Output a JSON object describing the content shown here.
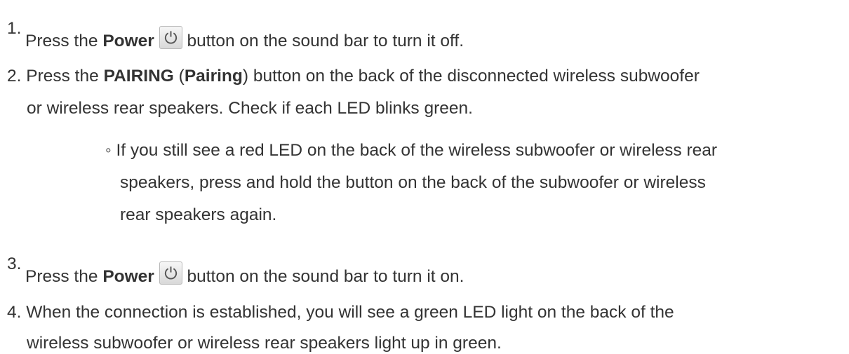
{
  "steps": [
    {
      "number": "1.",
      "before": "Press the ",
      "bold": "Power",
      "icon": "power-icon",
      "after": " button on the sound bar to turn it off."
    },
    {
      "number": "2.",
      "before": "Press the ",
      "bold1": "PAIRING",
      "paren_open": " (",
      "bold2": "Pairing",
      "paren_close": ")",
      "text_line1_rest": " button on the back of the disconnected wireless subwoofer",
      "text_line2": "or wireless rear speakers. Check if each LED blinks green.",
      "sub_bullet": {
        "marker": "◦",
        "line1": "If you still see a red LED on the back of the wireless subwoofer or wireless rear",
        "line2": "speakers, press and hold the button on the back of the subwoofer or wireless",
        "line3": "rear speakers again."
      }
    },
    {
      "number": "3.",
      "before": "Press the ",
      "bold": "Power",
      "icon": "power-icon",
      "after": " button on the sound bar to turn it on."
    },
    {
      "number": "4.",
      "line1": "When the connection is established, you will see a green LED light on the back of the",
      "line2": "wireless subwoofer or wireless rear speakers light up in green."
    }
  ],
  "colors": {
    "text": "#333333",
    "icon_border": "#b8b8b8"
  }
}
